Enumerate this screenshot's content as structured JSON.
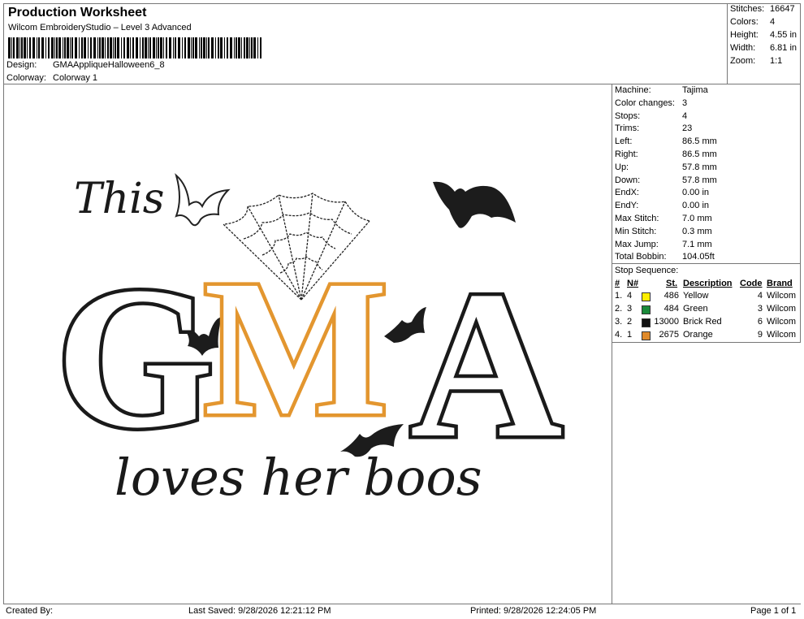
{
  "header": {
    "title": "Production Worksheet",
    "subtitle": "Wilcom EmbroideryStudio – Level 3 Advanced",
    "design_label": "Design:",
    "design_value": "GMAAppliqueHalloween6_8",
    "colorway_label": "Colorway:",
    "colorway_value": "Colorway 1"
  },
  "stats": {
    "stitches_label": "Stitches:",
    "stitches": "16647",
    "colors_label": "Colors:",
    "colors": "4",
    "height_label": "Height:",
    "height": "4.55 in",
    "width_label": "Width:",
    "width": "6.81 in",
    "zoom_label": "Zoom:",
    "zoom": "1:1"
  },
  "info": [
    {
      "label": "Machine:",
      "value": "Tajima"
    },
    {
      "label": "Color changes:",
      "value": "3"
    },
    {
      "label": "Stops:",
      "value": "4"
    },
    {
      "label": "Trims:",
      "value": "23"
    },
    {
      "label": "Left:",
      "value": "86.5 mm"
    },
    {
      "label": "Right:",
      "value": "86.5 mm"
    },
    {
      "label": "Up:",
      "value": "57.8 mm"
    },
    {
      "label": "Down:",
      "value": "57.8 mm"
    },
    {
      "label": "EndX:",
      "value": "0.00 in"
    },
    {
      "label": "EndY:",
      "value": "0.00 in"
    },
    {
      "label": "Max Stitch:",
      "value": "7.0 mm"
    },
    {
      "label": "Min Stitch:",
      "value": "0.3 mm"
    },
    {
      "label": "Max Jump:",
      "value": "7.1 mm"
    },
    {
      "label": "Total Bobbin:",
      "value": "104.05ft"
    }
  ],
  "stop_sequence": {
    "title": "Stop Sequence:",
    "headers": {
      "num": "#",
      "n": "N#",
      "st": "St.",
      "desc": "Description",
      "code": "Code",
      "brand": "Brand"
    },
    "rows": [
      {
        "num": "1.",
        "n": "4",
        "color": "#ffee00",
        "st": "486",
        "desc": "Yellow",
        "code": "4",
        "brand": "Wilcom"
      },
      {
        "num": "2.",
        "n": "3",
        "color": "#1a8a3a",
        "st": "484",
        "desc": "Green",
        "code": "3",
        "brand": "Wilcom"
      },
      {
        "num": "3.",
        "n": "2",
        "color": "#111111",
        "st": "13000",
        "desc": "Brick Red",
        "code": "6",
        "brand": "Wilcom"
      },
      {
        "num": "4.",
        "n": "1",
        "color": "#e08a2a",
        "st": "2675",
        "desc": "Orange",
        "code": "9",
        "brand": "Wilcom"
      }
    ]
  },
  "design": {
    "text_top": "This",
    "letter_1": "G",
    "letter_2": "M",
    "letter_3": "A",
    "text_bottom": "loves her boos",
    "outline_color": "#1a1a1a",
    "accent_color": "#e3962f"
  },
  "footer": {
    "created_by": "Created By:",
    "last_saved": "Last Saved: 9/28/2026 12:21:12 PM",
    "printed": "Printed: 9/28/2026 12:24:05 PM",
    "page": "Page 1 of 1"
  }
}
